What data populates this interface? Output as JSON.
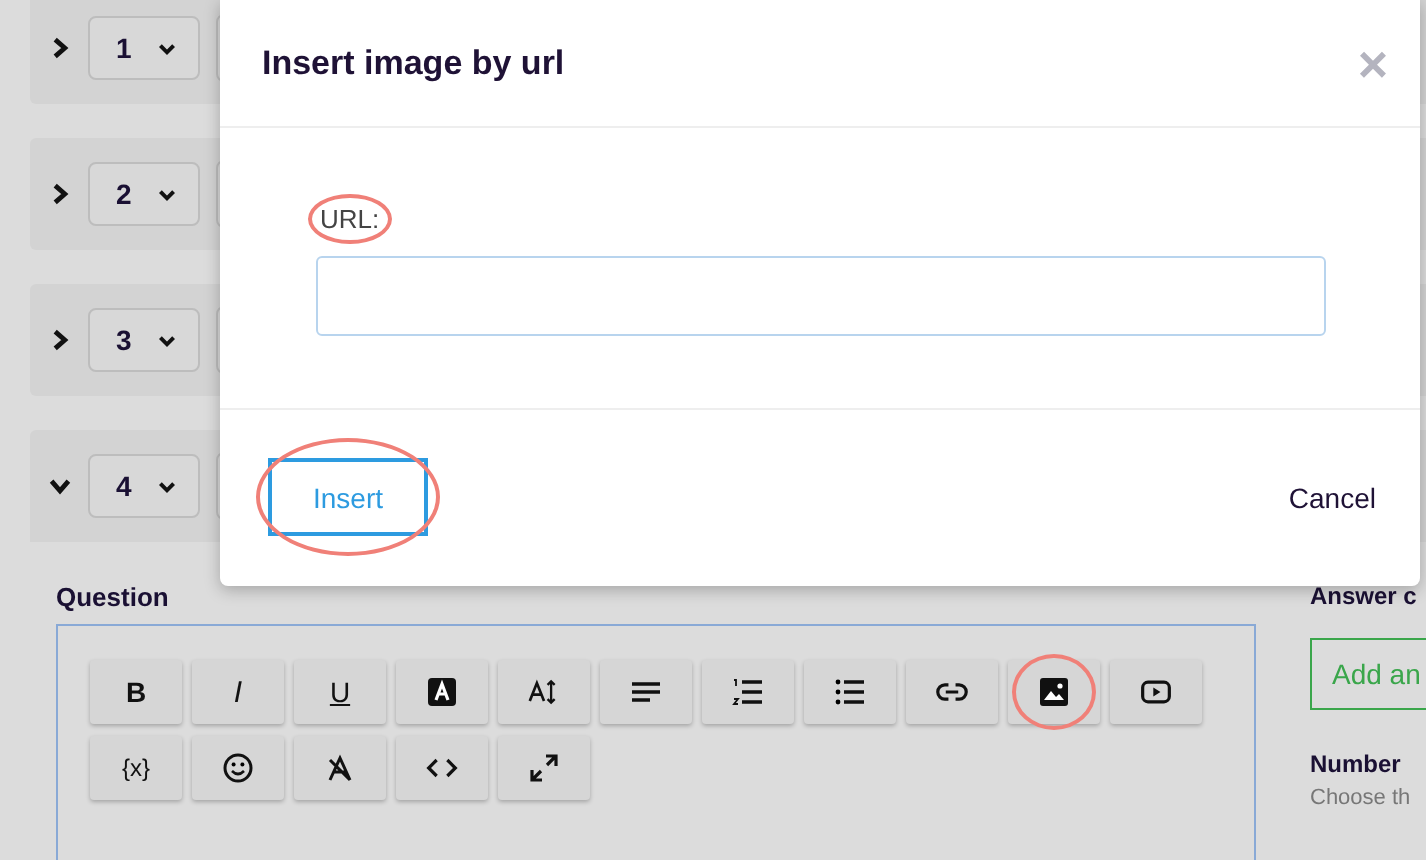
{
  "questions": [
    {
      "number": "1",
      "expanded": false
    },
    {
      "number": "2",
      "expanded": false
    },
    {
      "number": "3",
      "expanded": false
    },
    {
      "number": "4",
      "expanded": true
    }
  ],
  "editor": {
    "label": "Question",
    "toolbar": [
      {
        "kind": "bold",
        "text": "B"
      },
      {
        "kind": "italic",
        "text": "I"
      },
      {
        "kind": "underline",
        "text": "U"
      },
      {
        "kind": "text-color"
      },
      {
        "kind": "font-size"
      },
      {
        "kind": "align"
      },
      {
        "kind": "ordered-list"
      },
      {
        "kind": "bullet-list"
      },
      {
        "kind": "link"
      },
      {
        "kind": "image",
        "highlighted": true
      },
      {
        "kind": "video"
      },
      {
        "kind": "formula",
        "text": "{x}"
      },
      {
        "kind": "emoji"
      },
      {
        "kind": "clear-format"
      },
      {
        "kind": "code"
      },
      {
        "kind": "fullscreen"
      }
    ]
  },
  "side": {
    "answer_heading": "Answer c",
    "add_button": "Add an",
    "number_heading": "Number",
    "number_hint": "Choose th"
  },
  "modal": {
    "title": "Insert image by url",
    "close": "×",
    "url_label": "URL:",
    "url_label_highlighted": true,
    "insert_button": "Insert",
    "insert_highlighted": true,
    "cancel_button": "Cancel"
  }
}
